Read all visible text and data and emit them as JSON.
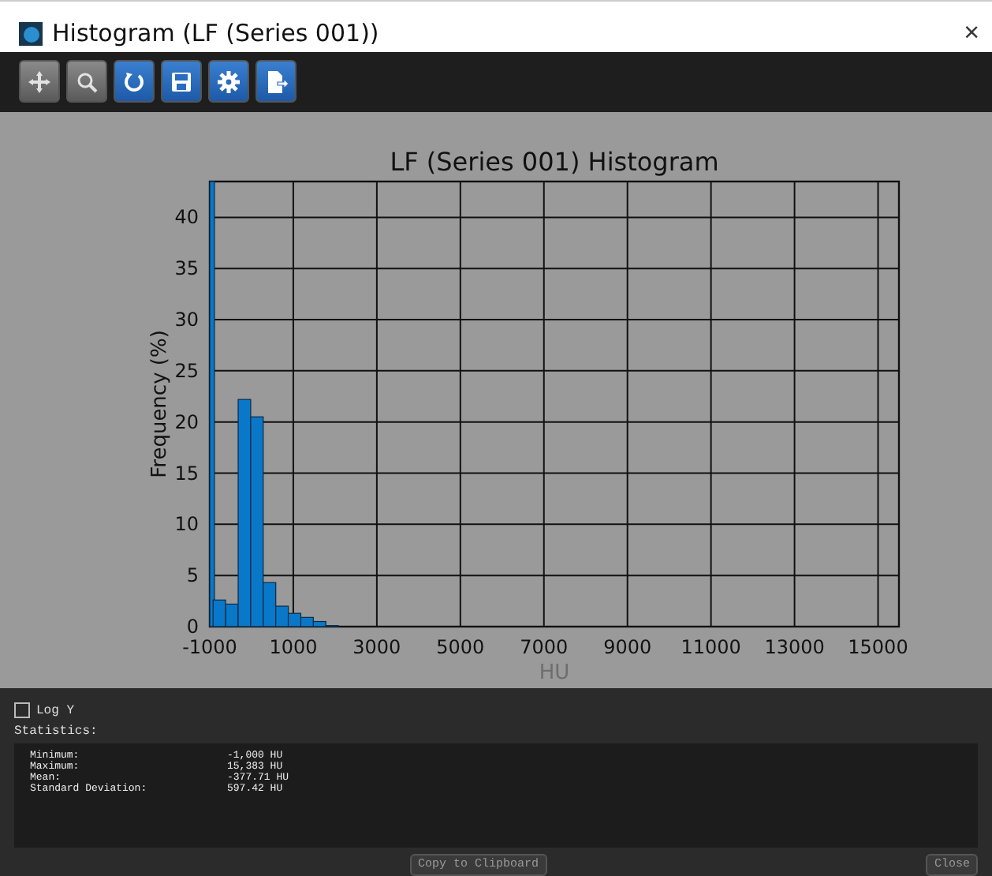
{
  "window": {
    "title": "Histogram (LF (Series 001))",
    "close": "×"
  },
  "toolbar": {
    "buttons": [
      {
        "kind": "move",
        "enabled": false
      },
      {
        "kind": "zoom",
        "enabled": false
      },
      {
        "kind": "reset",
        "enabled": true
      },
      {
        "kind": "save",
        "enabled": true
      },
      {
        "kind": "settings",
        "enabled": true
      },
      {
        "kind": "export",
        "enabled": true
      }
    ]
  },
  "chart": {
    "chart_data": {
      "type": "bar",
      "title": "LF (Series 001) Histogram",
      "xlabel": "HU",
      "ylabel": "Frequency (%)",
      "x": [
        -960,
        -770,
        -470,
        -170,
        130,
        430,
        730,
        1030,
        1330,
        1630,
        1930
      ],
      "values": [
        43.5,
        2.6,
        2.2,
        22.2,
        20.5,
        4.3,
        2.0,
        1.3,
        0.9,
        0.5,
        0.1
      ],
      "grid": true,
      "xlim": [
        -1000,
        15500
      ],
      "ylim": [
        0,
        43.5
      ],
      "xticks": [
        -1000,
        1000,
        3000,
        5000,
        7000,
        9000,
        11000,
        13000,
        15000
      ],
      "yticks": [
        0,
        5,
        10,
        15,
        20,
        25,
        30,
        35,
        40
      ]
    }
  },
  "log_y": {
    "label": "Log Y",
    "checked": false
  },
  "statistics": {
    "heading": "Statistics:",
    "rows": [
      {
        "label": "Minimum:",
        "value": "-1,000 HU"
      },
      {
        "label": "Maximum:",
        "value": "15,383 HU"
      },
      {
        "label": "Mean:",
        "value": "-377.71 HU"
      },
      {
        "label": "Standard Deviation:",
        "value": "597.42 HU"
      }
    ]
  },
  "buttons": [
    {
      "kind": "copy",
      "label": "Copy to Clipboard"
    },
    {
      "kind": "close",
      "label": "Close"
    }
  ]
}
